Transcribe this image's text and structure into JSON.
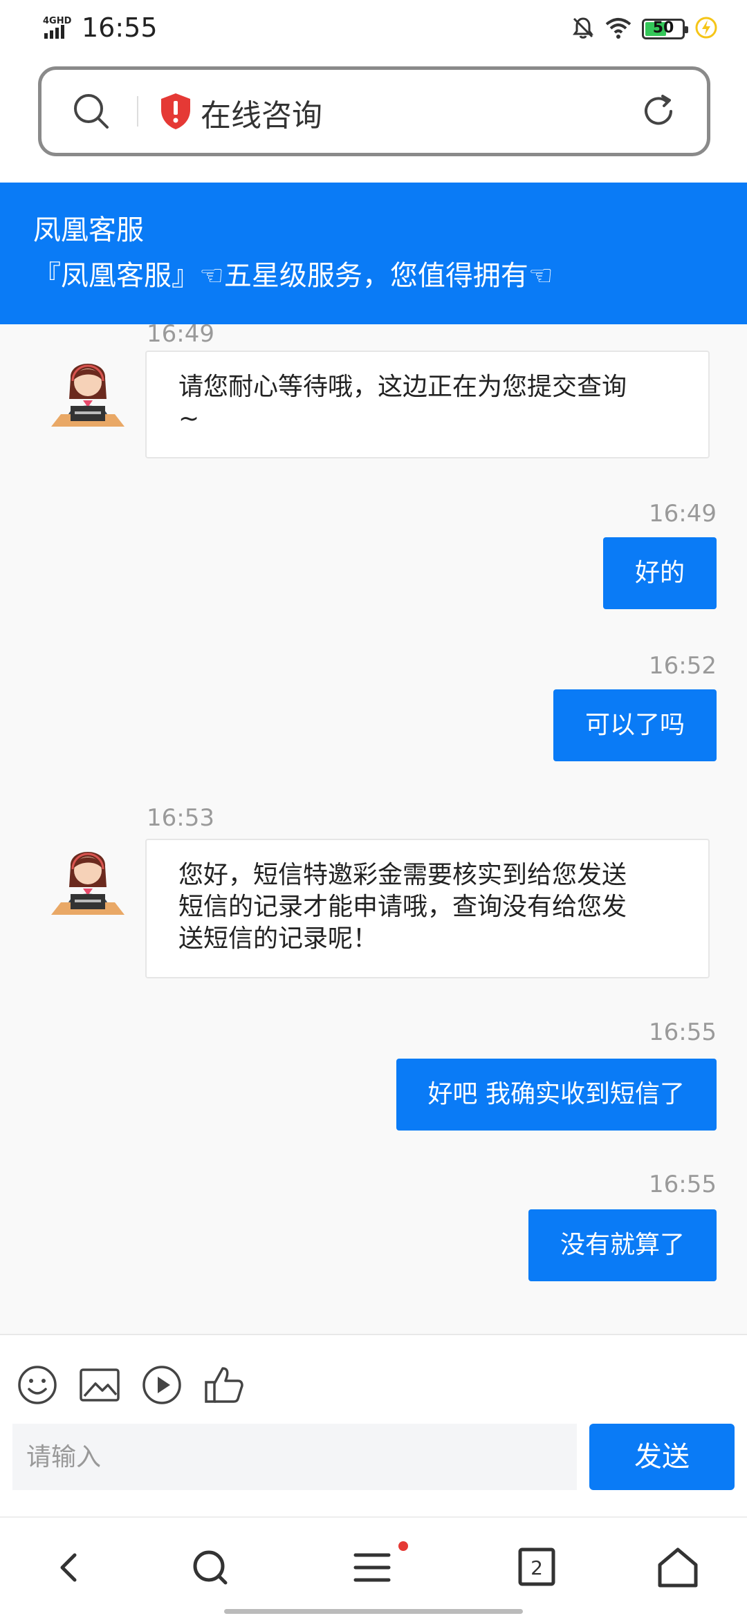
{
  "status_bar": {
    "network": "4GHD",
    "time": "16:55",
    "battery": "50"
  },
  "address_bar": {
    "title": "在线咨询"
  },
  "header": {
    "name": "凤凰客服",
    "slogan": "『凤凰客服』☜五星级服务，您值得拥有☜"
  },
  "messages": [
    {
      "from": "agent",
      "time": "16:49",
      "lines": [
        "请您耐心等待哦，这边正在为您提交查询",
        "~"
      ]
    },
    {
      "from": "user",
      "time": "16:49",
      "text": "好的"
    },
    {
      "from": "user",
      "time": "16:52",
      "text": "可以了吗"
    },
    {
      "from": "agent",
      "time": "16:53",
      "lines": [
        "您好，短信特邀彩金需要核实到给您发送",
        "短信的记录才能申请哦，查询没有给您发",
        "送短信的记录呢！"
      ]
    },
    {
      "from": "user",
      "time": "16:55",
      "text": "好吧 我确实收到短信了"
    },
    {
      "from": "user",
      "time": "16:55",
      "text": "没有就算了"
    }
  ],
  "input": {
    "placeholder": "请输入",
    "send_label": "发送"
  },
  "nav": {
    "tab_count": "2"
  },
  "colors": {
    "accent": "#0a7bf6",
    "shield": "#e53935",
    "battery": "#34c759"
  }
}
